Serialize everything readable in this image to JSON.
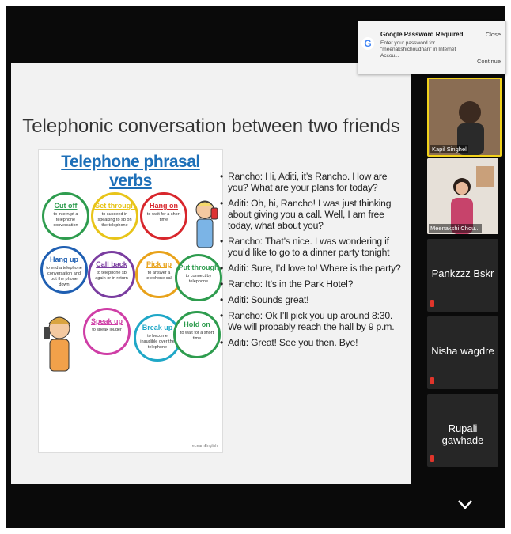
{
  "slide": {
    "title": "Telephonic conversation between two friends",
    "infographic": {
      "title": "Telephone phrasal verbs",
      "credit": "eLearnEnglish",
      "verbs": [
        {
          "verb": "Cut off",
          "def": "to interrupt a telephone conversation",
          "color": "#2e9c4e"
        },
        {
          "verb": "Get through",
          "def": "to succeed in speaking to sb on the telephone",
          "color": "#e8c418"
        },
        {
          "verb": "Hang on",
          "def": "to wait for a short time",
          "color": "#d8262c"
        },
        {
          "verb": "Hang up",
          "def": "to end a telephone conversation and put the phone down",
          "color": "#1f5fb2"
        },
        {
          "verb": "Call back",
          "def": "to telephone sb again or in return",
          "color": "#7a3da0"
        },
        {
          "verb": "Pick up",
          "def": "to answer a telephone call",
          "color": "#e8a21a"
        },
        {
          "verb": "Put through",
          "def": "to connect by telephone",
          "color": "#2e9c4e"
        },
        {
          "verb": "Speak up",
          "def": "to speak louder",
          "color": "#cf3ea6"
        },
        {
          "verb": "Break up",
          "def": "to become inaudible over the telephone",
          "color": "#1fa7c7"
        },
        {
          "verb": "Hold on",
          "def": "to wait for a short time",
          "color": "#2e9c4e"
        }
      ]
    },
    "bullets": [
      "Rancho: Hi, Aditi, it’s Rancho. How are you? What are your plans for today?",
      "Aditi: Oh, hi, Rancho! I was just thinking about giving you a call. Well, I am free today, what about you?",
      "Rancho: That’s nice. I was wondering if you’d like to go to a dinner party tonight",
      "Aditi: Sure, I’d love to! Where is the party?",
      "Rancho: It’s in the Park Hotel?",
      "Aditi: Sounds great!",
      "Rancho: Ok I’ll pick you up around 8:30. We will probably reach the hall by 9 p.m.",
      "Aditi: Great! See you then. Bye!"
    ]
  },
  "participants": [
    {
      "name": "Kapil Singhel",
      "type": "video"
    },
    {
      "name": "Meenakshi Chou...",
      "type": "video"
    },
    {
      "name": "Pankzzz Bskr",
      "type": "name"
    },
    {
      "name": "Nisha wagdre",
      "type": "name"
    },
    {
      "name": "Rupali gawhade",
      "type": "name"
    }
  ],
  "popup": {
    "title": "Google Password Required",
    "body": "Enter your password for \"meenakshichoudhari\" in Internet Accou...",
    "close": "Close",
    "continue": "Continue"
  },
  "colors": {
    "active_speaker": "#f2d21b",
    "mic_muted": "#e0352b"
  }
}
